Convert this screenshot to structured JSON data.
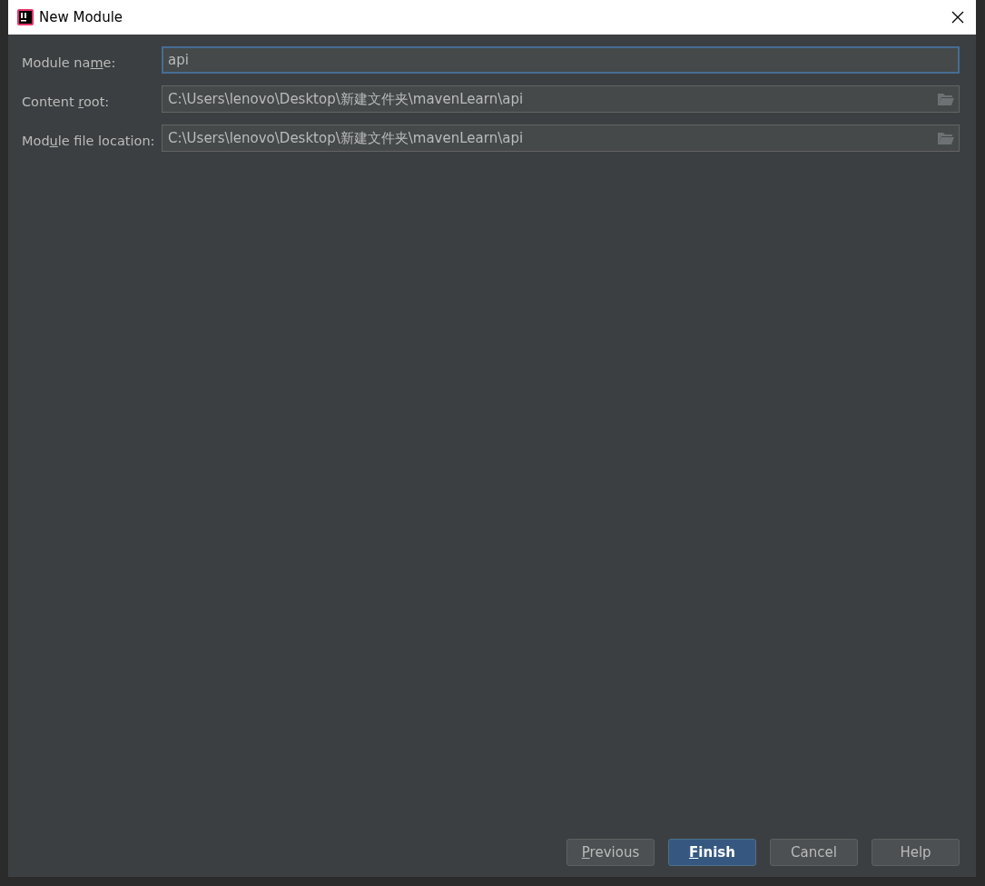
{
  "window": {
    "title": "New Module"
  },
  "fields": [
    {
      "kind": "text",
      "label_before": "Module na",
      "mnemonic": "m",
      "label_after": "e:",
      "value": "api",
      "focused": true
    },
    {
      "kind": "path",
      "label_before": "Content ",
      "mnemonic": "r",
      "label_after": "oot:",
      "value": "C:\\Users\\lenovo\\Desktop\\新建文件夹\\mavenLearn\\api",
      "focused": false
    },
    {
      "kind": "path",
      "label_before": "Mod",
      "mnemonic": "u",
      "label_after": "le file location:",
      "value": "C:\\Users\\lenovo\\Desktop\\新建文件夹\\mavenLearn\\api",
      "focused": false
    }
  ],
  "buttons": [
    {
      "mnemonic": "P",
      "label_after": "revious",
      "default": false
    },
    {
      "mnemonic": "F",
      "label_after": "inish",
      "default": true
    },
    {
      "label_after": "Cancel",
      "default": false
    },
    {
      "label_after": "Help",
      "default": false
    }
  ]
}
